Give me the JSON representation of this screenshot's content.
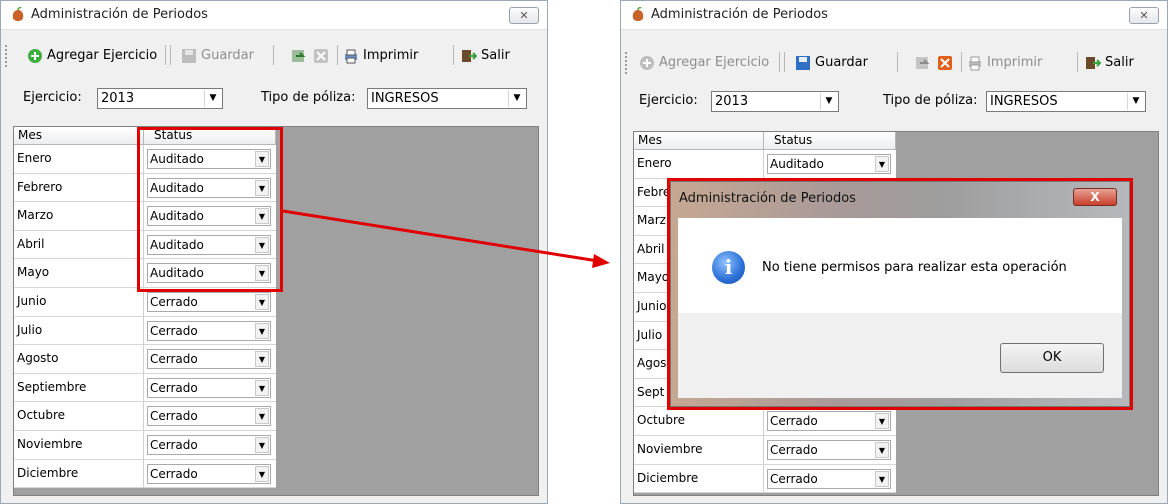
{
  "window": {
    "title": "Administración de Periodos",
    "close_glyph": "✕"
  },
  "toolbar": {
    "add_label": "Agregar Ejercicio",
    "save_label": "Guardar",
    "print_label": "Imprimir",
    "exit_label": "Salir"
  },
  "filters": {
    "ejercicio_label": "Ejercicio:",
    "ejercicio_value": "2013",
    "tipo_label": "Tipo de póliza:",
    "tipo_value": "INGRESOS"
  },
  "grid": {
    "col_mes": "Mes",
    "col_status": "Status",
    "rows": [
      {
        "mes": "Enero",
        "status": "Auditado"
      },
      {
        "mes": "Febrero",
        "status": "Auditado"
      },
      {
        "mes": "Marzo",
        "status": "Auditado"
      },
      {
        "mes": "Abril",
        "status": "Auditado"
      },
      {
        "mes": "Mayo",
        "status": "Auditado"
      },
      {
        "mes": "Junio",
        "status": "Cerrado"
      },
      {
        "mes": "Julio",
        "status": "Cerrado"
      },
      {
        "mes": "Agosto",
        "status": "Cerrado"
      },
      {
        "mes": "Septiembre",
        "status": "Cerrado"
      },
      {
        "mes": "Octubre",
        "status": "Cerrado"
      },
      {
        "mes": "Noviembre",
        "status": "Cerrado"
      },
      {
        "mes": "Diciembre",
        "status": "Cerrado"
      }
    ],
    "right_rows": [
      {
        "mes": "Enero",
        "status": "Auditado"
      },
      {
        "mes": "Febre",
        "status": ""
      },
      {
        "mes": "Marz",
        "status": ""
      },
      {
        "mes": "Abril",
        "status": ""
      },
      {
        "mes": "Mayo",
        "status": ""
      },
      {
        "mes": "Junio",
        "status": ""
      },
      {
        "mes": "Julio",
        "status": ""
      },
      {
        "mes": "Agos",
        "status": ""
      },
      {
        "mes": "Sept",
        "status": ""
      },
      {
        "mes": "Octubre",
        "status": "Cerrado"
      },
      {
        "mes": "Noviembre",
        "status": "Cerrado"
      },
      {
        "mes": "Diciembre",
        "status": "Cerrado"
      }
    ]
  },
  "dialog": {
    "title": "Administración de Periodos",
    "close_glyph": "X",
    "message": "No tiene permisos para realizar esta operación",
    "ok_label": "OK",
    "icon": "info-icon"
  },
  "colors": {
    "highlight": "#e00000",
    "grid_background": "#a0a0a0"
  }
}
